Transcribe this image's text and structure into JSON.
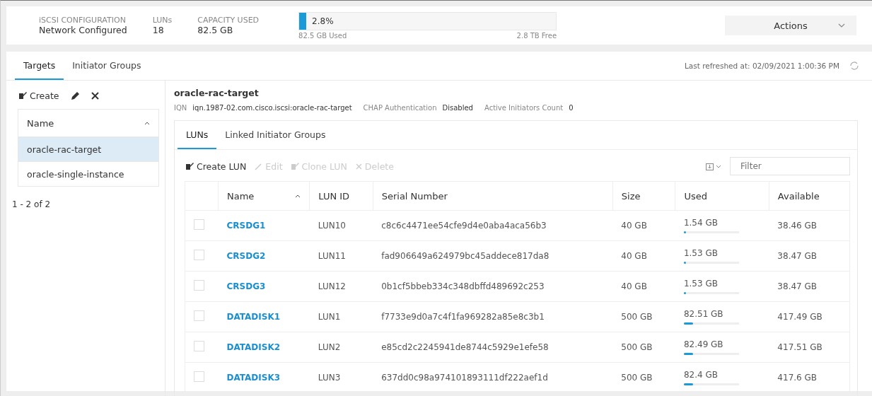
{
  "summary": {
    "config_label": "iSCSI CONFIGURATION",
    "config_value": "Network Configured",
    "luns_label": "LUNs",
    "luns_value": "18",
    "capacity_label": "CAPACITY USED",
    "capacity_value": "82.5 GB",
    "capacity_percent": "2.8%",
    "level": 0.028,
    "used_text": "82.5 GB Used",
    "free_text": "2.8 TB Free",
    "actions": "Actions"
  },
  "tabs": [
    {
      "label": "Targets",
      "selected": true
    },
    {
      "label": "Initiator Groups",
      "selected": false
    }
  ],
  "last_refreshed": "Last refreshed at: 02/09/2021 1:00:36 PM",
  "sidebar": {
    "create": "Create",
    "column": "Name",
    "items": [
      {
        "label": "oracle-rac-target",
        "selected": true
      },
      {
        "label": "oracle-single-instance",
        "selected": false
      }
    ],
    "pagination": "1 - 2 of 2"
  },
  "target": {
    "title": "oracle-rac-target",
    "fields": [
      {
        "label": "IQN",
        "value": "iqn.1987-02.com.cisco.iscsi:oracle-rac-target"
      },
      {
        "label": "CHAP Authentication",
        "value": "Disabled"
      },
      {
        "label": "Active Initiators Count",
        "value": "0"
      }
    ]
  },
  "subtabs": [
    {
      "label": "LUNs",
      "selected": true
    },
    {
      "label": "Linked Initiator Groups",
      "selected": false
    }
  ],
  "toolbar": [
    {
      "label": "Create LUN",
      "kind": "create",
      "disabled": false
    },
    {
      "label": "Edit",
      "kind": "edit",
      "disabled": true
    },
    {
      "label": "Clone LUN",
      "kind": "create",
      "disabled": true
    },
    {
      "label": "Delete",
      "kind": "delete",
      "disabled": true
    }
  ],
  "filter": {
    "placeholder": "Filter"
  },
  "table": {
    "columns": [
      "Name",
      "LUN ID",
      "Serial Number",
      "Size",
      "Used",
      "Available"
    ],
    "rows": [
      {
        "checked": false,
        "name": "CRSDG1",
        "lun_id": "LUN10",
        "serial": "c8c6c4471ee54cfe9d4e0aba4aca56b3",
        "size": "40 GB",
        "used": "1.54 GB",
        "level": 0.0385,
        "available": "38.46 GB"
      },
      {
        "checked": false,
        "name": "CRSDG2",
        "lun_id": "LUN11",
        "serial": "fad906649a624979bc45addece817da8",
        "size": "40 GB",
        "used": "1.53 GB",
        "level": 0.038,
        "available": "38.47 GB"
      },
      {
        "checked": false,
        "name": "CRSDG3",
        "lun_id": "LUN12",
        "serial": "0b1cf5bbeb334c348dbffd489692c253",
        "size": "40 GB",
        "used": "1.53 GB",
        "level": 0.038,
        "available": "38.47 GB"
      },
      {
        "checked": false,
        "name": "DATADISK1",
        "lun_id": "LUN1",
        "serial": "f7733e9d0a7c4f1fa969282a85e8c3b1",
        "size": "500 GB",
        "used": "82.51 GB",
        "level": 0.165,
        "available": "417.49 GB"
      },
      {
        "checked": false,
        "name": "DATADISK2",
        "lun_id": "LUN2",
        "serial": "e85cd2c2245941de8744c5929e1efe58",
        "size": "500 GB",
        "used": "82.49 GB",
        "level": 0.165,
        "available": "417.51 GB"
      },
      {
        "checked": false,
        "name": "DATADISK3",
        "lun_id": "LUN3",
        "serial": "637dd0c98a974101893111df222aef1d",
        "size": "500 GB",
        "used": "82.4 GB",
        "level": 0.165,
        "available": "417.6 GB"
      }
    ]
  }
}
